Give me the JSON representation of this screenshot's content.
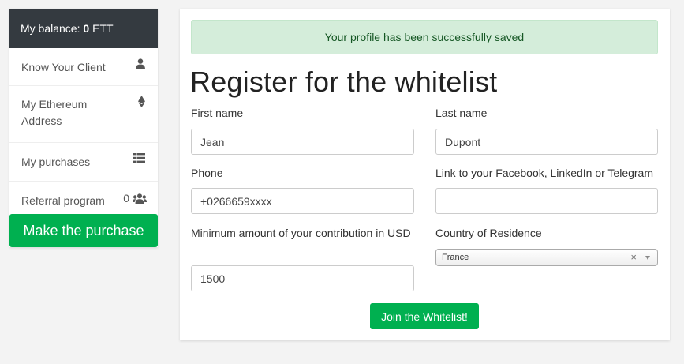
{
  "sidebar": {
    "balance_label": "My balance:",
    "balance_value": "0",
    "balance_unit": "ETT",
    "items": [
      {
        "label": "Know Your Client",
        "icon": "user-icon"
      },
      {
        "label": "My Ethereum Address",
        "icon": "ethereum-icon"
      },
      {
        "label": "My purchases",
        "icon": "list-icon"
      },
      {
        "label": "Referral program",
        "count": "0",
        "icon": "users-icon"
      }
    ],
    "purchase_button": "Make the purchase"
  },
  "alert": {
    "text": "Your profile has been successfully saved"
  },
  "form": {
    "title": "Register for the whitelist",
    "first_name": {
      "label": "First name",
      "value": "Jean"
    },
    "last_name": {
      "label": "Last name",
      "value": "Dupont"
    },
    "phone": {
      "label": "Phone",
      "value": "+0266659xxxx"
    },
    "social": {
      "label": "Link to your Facebook, LinkedIn or Telegram",
      "value": ""
    },
    "min_amount": {
      "label": "Minimum amount of your contribution in USD",
      "value": "1500"
    },
    "country": {
      "label": "Country of Residence",
      "value": "France",
      "clear": "×"
    },
    "submit_label": "Join the Whitelist!"
  },
  "colors": {
    "accent": "#00b050",
    "sidebar_header": "#343a40",
    "alert_bg": "#d4edda",
    "alert_text": "#155724"
  }
}
